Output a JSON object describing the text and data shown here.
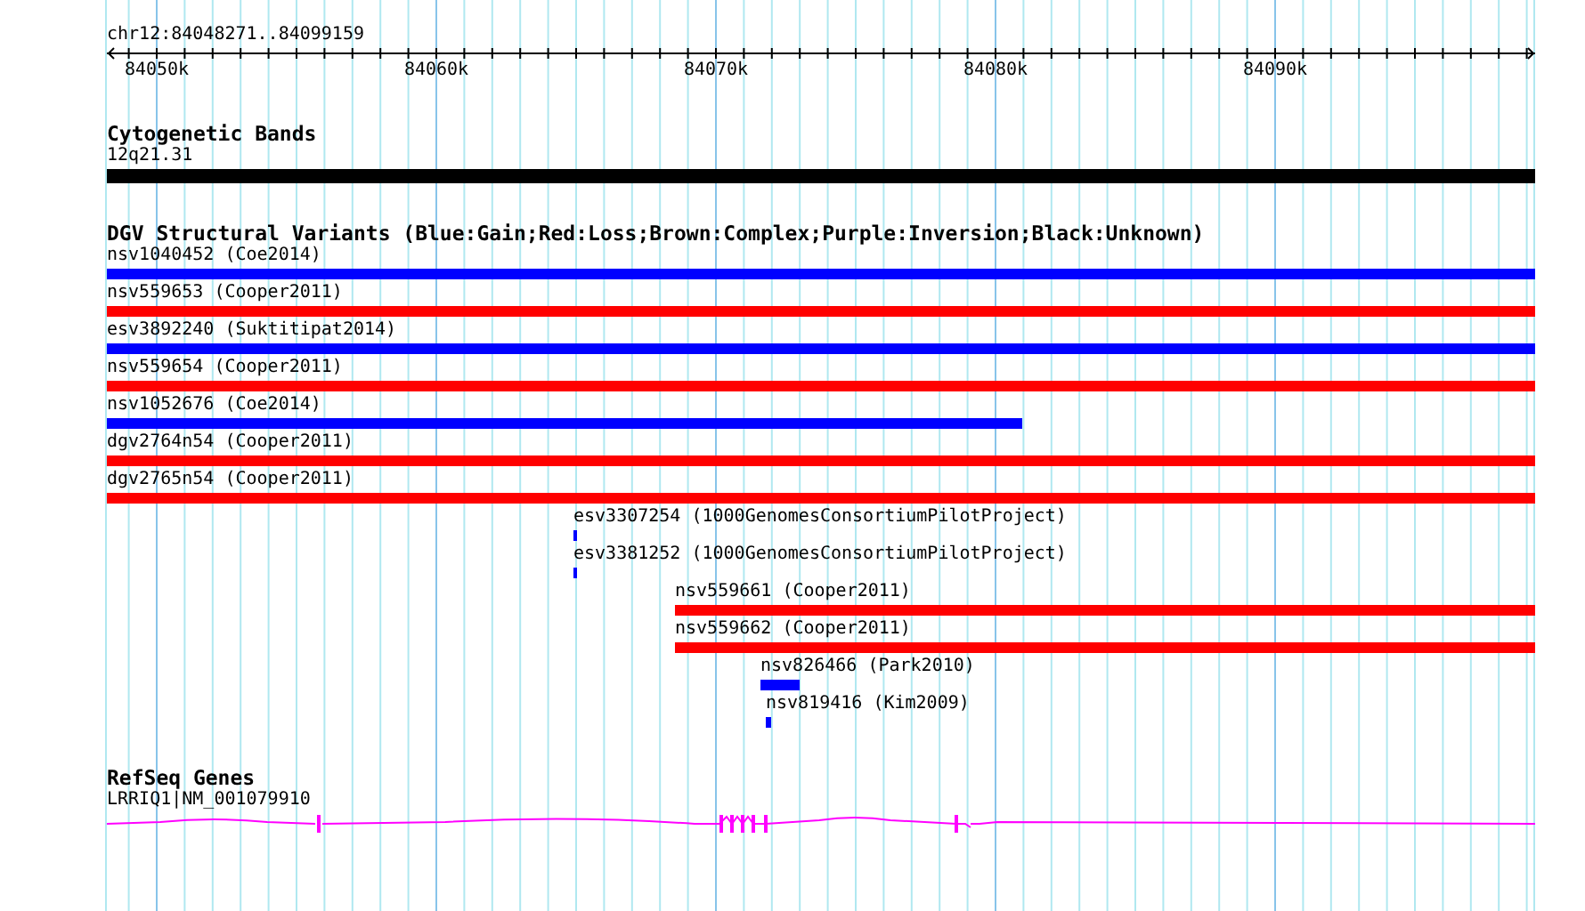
{
  "location": "chr12:84048271..84099159",
  "ruler": {
    "ticks": [
      "84050k",
      "84060k",
      "84070k",
      "84080k",
      "84090k"
    ]
  },
  "tracks": [
    {
      "kind": "bands",
      "title": "Cytogenetic Bands",
      "features": [
        {
          "label": "12q21.31",
          "color": "#000000"
        }
      ]
    },
    {
      "kind": "variants",
      "title": "DGV Structural Variants (Blue:Gain;Red:Loss;Brown:Complex;Purple:Inversion;Black:Unknown)",
      "features": [
        {
          "label": "nsv1040452 (Coe2014)",
          "color": "#0000ff"
        },
        {
          "label": "nsv559653 (Cooper2011)",
          "color": "#ff0000"
        },
        {
          "label": "esv3892240 (Suktitipat2014)",
          "color": "#0000ff"
        },
        {
          "label": "nsv559654 (Cooper2011)",
          "color": "#ff0000"
        },
        {
          "label": "nsv1052676 (Coe2014)",
          "color": "#0000ff"
        },
        {
          "label": "dgv2764n54 (Cooper2011)",
          "color": "#ff0000"
        },
        {
          "label": "dgv2765n54 (Cooper2011)",
          "color": "#ff0000"
        },
        {
          "label": "esv3307254 (1000GenomesConsortiumPilotProject)",
          "color": "#0000ff"
        },
        {
          "label": "esv3381252 (1000GenomesConsortiumPilotProject)",
          "color": "#0000ff"
        },
        {
          "label": "nsv559661 (Cooper2011)",
          "color": "#ff0000"
        },
        {
          "label": "nsv559662 (Cooper2011)",
          "color": "#ff0000"
        },
        {
          "label": "nsv826466 (Park2010)",
          "color": "#0000ff"
        },
        {
          "label": "nsv819416 (Kim2009)",
          "color": "#0000ff"
        }
      ]
    },
    {
      "kind": "genes",
      "title": "RefSeq Genes",
      "features": [
        {
          "label": "LRRIQ1|NM_001079910",
          "color": "#ff00ff"
        }
      ]
    }
  ]
}
